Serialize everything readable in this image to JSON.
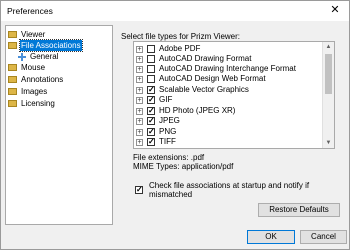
{
  "window": {
    "title": "Preferences",
    "close_glyph": "✕"
  },
  "nav": {
    "items": [
      {
        "label": "Viewer",
        "selected": false
      },
      {
        "label": "File Associations",
        "selected": true
      },
      {
        "label": "Mouse",
        "selected": false
      },
      {
        "label": "Annotations",
        "selected": false
      },
      {
        "label": "Images",
        "selected": false
      },
      {
        "label": "Licensing",
        "selected": false
      }
    ],
    "sub_items": [
      {
        "label": "General"
      }
    ]
  },
  "file_types": {
    "heading": "Select file types for Prizm Viewer:",
    "items": [
      {
        "label": "Adobe PDF",
        "checked": false
      },
      {
        "label": "AutoCAD Drawing Format",
        "checked": false
      },
      {
        "label": "AutoCAD Drawing Interchange Format",
        "checked": false
      },
      {
        "label": "AutoCAD Design Web Format",
        "checked": false
      },
      {
        "label": "Scalable Vector Graphics",
        "checked": true
      },
      {
        "label": "GIF",
        "checked": true
      },
      {
        "label": "HD Photo (JPEG XR)",
        "checked": true
      },
      {
        "label": "JPEG",
        "checked": true
      },
      {
        "label": "PNG",
        "checked": true
      },
      {
        "label": "TIFF",
        "checked": true
      }
    ],
    "expander_glyph": "+",
    "check_glyph": "✓"
  },
  "details": {
    "extensions": "File extensions: .pdf",
    "mime": "MIME Types: application/pdf"
  },
  "startup_check": {
    "label": "Check file associations at startup and notify if mismatched",
    "checked": true
  },
  "buttons": {
    "restore": "Restore Defaults",
    "ok": "OK",
    "cancel": "Cancel"
  },
  "scroll": {
    "up": "▲",
    "down": "▼"
  }
}
